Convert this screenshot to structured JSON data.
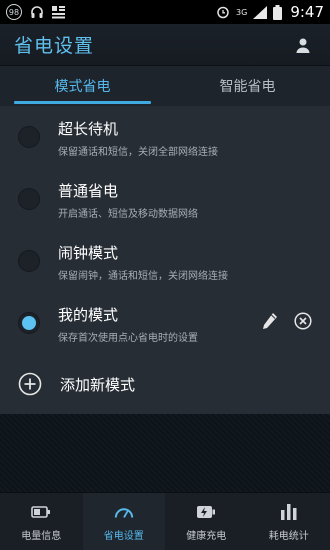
{
  "status_bar": {
    "badge": "98",
    "network": "3G",
    "time": "9:47"
  },
  "header": {
    "title": "省电设置"
  },
  "tabs": [
    {
      "label": "模式省电",
      "active": true
    },
    {
      "label": "智能省电",
      "active": false
    }
  ],
  "modes": [
    {
      "title": "超长待机",
      "description": "保留通话和短信，关闭全部网络连接",
      "selected": false
    },
    {
      "title": "普通省电",
      "description": "开启通话、短信及移动数据网络",
      "selected": false
    },
    {
      "title": "闹钟模式",
      "description": "保留闹钟，通话和短信，关闭网络连接",
      "selected": false
    },
    {
      "title": "我的模式",
      "description": "保存首次使用点心省电时的设置",
      "selected": true
    }
  ],
  "add_mode": {
    "label": "添加新模式"
  },
  "bottom_nav": [
    {
      "label": "电量信息",
      "icon": "battery-icon",
      "active": false
    },
    {
      "label": "省电设置",
      "icon": "speedometer-icon",
      "active": true
    },
    {
      "label": "健康充电",
      "icon": "charging-icon",
      "active": false
    },
    {
      "label": "耗电统计",
      "icon": "bar-chart-icon",
      "active": false
    }
  ],
  "colors": {
    "accent": "#56b9ec",
    "list_bg": "#272d35",
    "header_bg": "#1b2129"
  }
}
